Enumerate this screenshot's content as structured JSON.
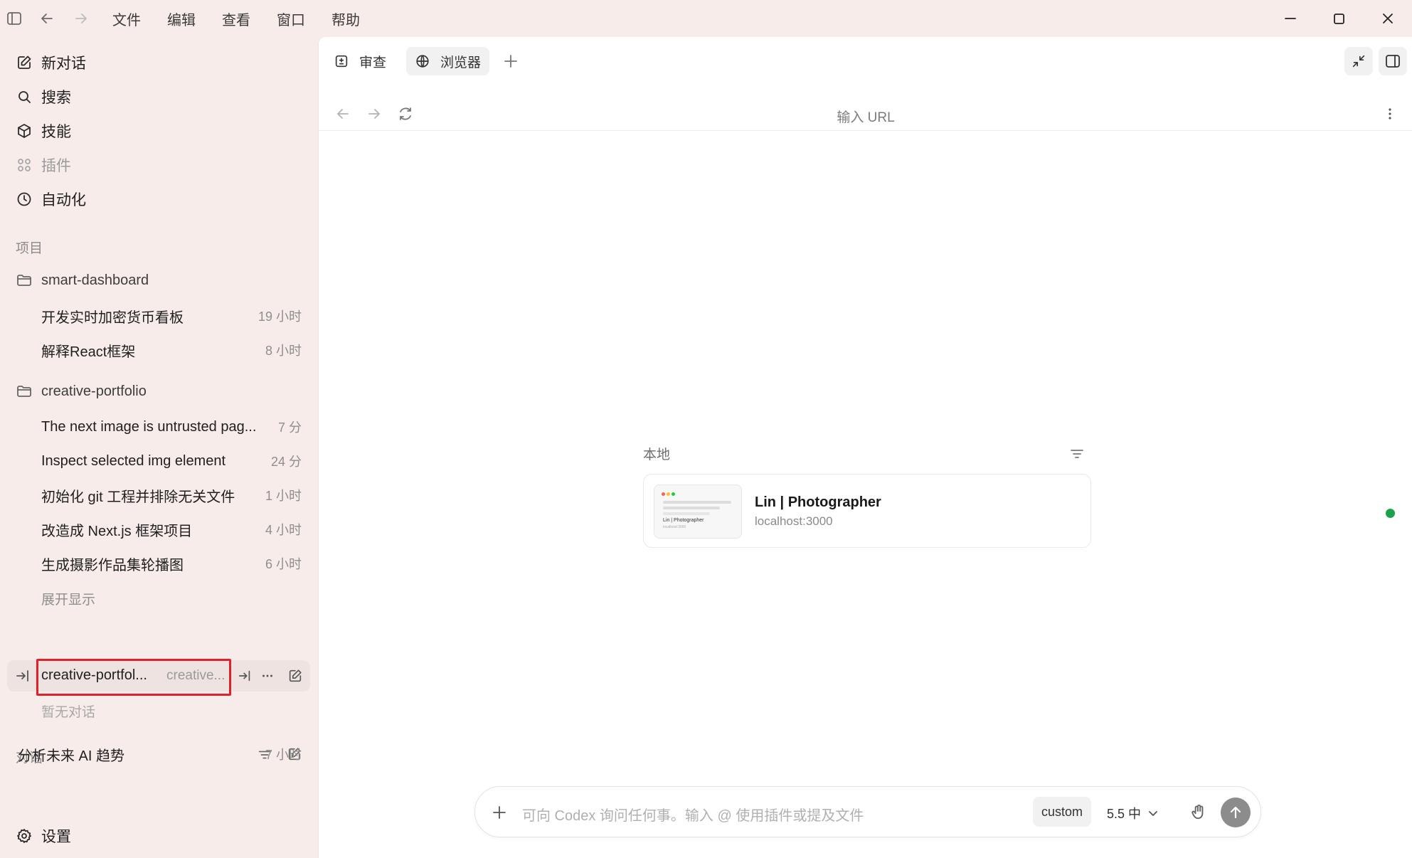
{
  "menu": [
    "文件",
    "编辑",
    "查看",
    "窗口",
    "帮助"
  ],
  "sidebar": {
    "nav": [
      {
        "label": "新对话",
        "icon": "compose-icon"
      },
      {
        "label": "搜索",
        "icon": "search-icon"
      },
      {
        "label": "技能",
        "icon": "cube-icon"
      },
      {
        "label": "插件",
        "icon": "grid-icon"
      },
      {
        "label": "自动化",
        "icon": "clock-icon"
      }
    ],
    "projects_label": "项目",
    "projects": [
      {
        "name": "smart-dashboard",
        "threads": [
          {
            "title": "开发实时加密货币看板",
            "time": "19 小时"
          },
          {
            "title": "解释React框架",
            "time": "8 小时"
          }
        ]
      },
      {
        "name": "creative-portfolio",
        "threads": [
          {
            "title": "The next image is untrusted pag...",
            "time": "7 分"
          },
          {
            "title": "Inspect selected img element",
            "time": "24 分"
          },
          {
            "title": "初始化 git 工程并排除无关文件",
            "time": "1 小时"
          },
          {
            "title": "改造成 Next.js 框架项目",
            "time": "4 小时"
          },
          {
            "title": "生成摄影作品集轮播图",
            "time": "6 小时"
          }
        ],
        "expand_label": "展开显示"
      }
    ],
    "worktree": {
      "name": "creative-portfol...",
      "branch": "creative..."
    },
    "empty_label": "暂无对话",
    "conversations_label": "对话",
    "conversations": [
      {
        "title": "分析未来 AI 趋势",
        "time": "7 小时"
      }
    ],
    "settings_label": "设置"
  },
  "tabs": [
    {
      "label": "审查",
      "icon": "diff-icon"
    },
    {
      "label": "浏览器",
      "icon": "globe-icon",
      "active": true
    }
  ],
  "browser": {
    "url_placeholder": "输入 URL",
    "local_label": "本地",
    "card": {
      "title": "Lin | Photographer",
      "url": "localhost:3000",
      "thumb_title": "Lin | Photographer",
      "thumb_sub": "localhost:3000",
      "status_color": "#1aa34a"
    }
  },
  "composer": {
    "placeholder": "可向 Codex 询问任何事。输入 @ 使用插件或提及文件",
    "mode_chip": "custom",
    "model": "5.5 中"
  },
  "colors": {
    "sidebar_bg": "#f7ecea",
    "highlight": "#e0202a",
    "send_button": "#8c8c8c"
  }
}
